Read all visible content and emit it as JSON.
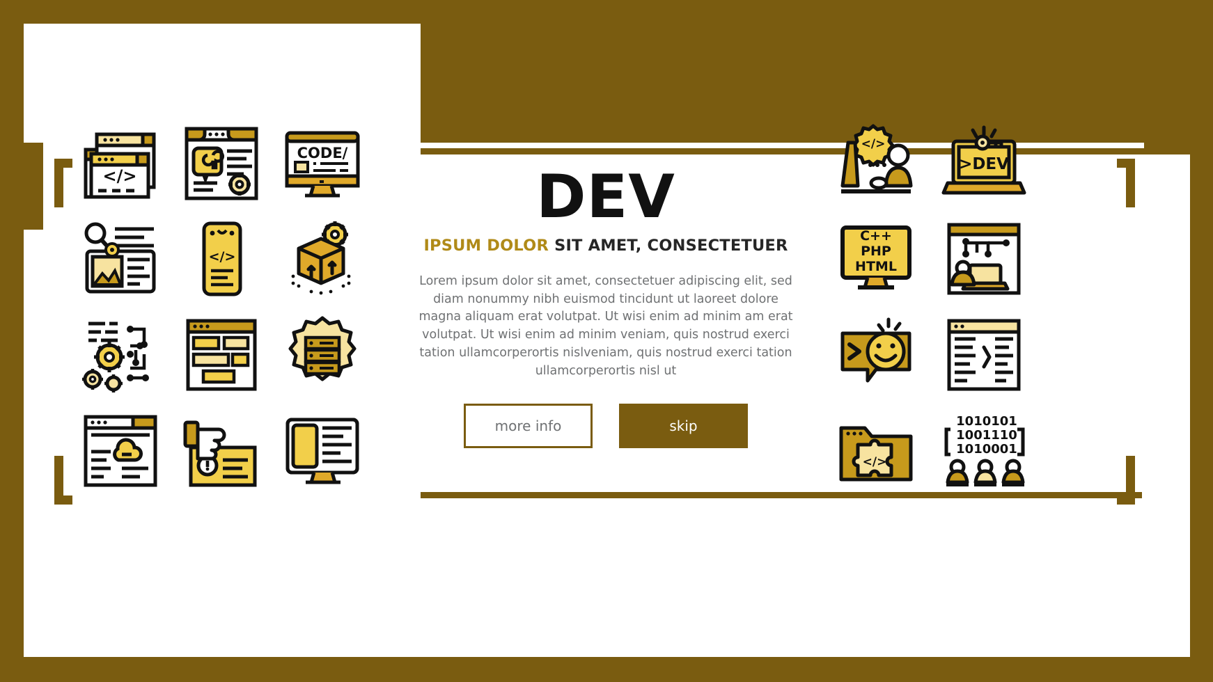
{
  "palette": {
    "brand_brown": "#7a5c10",
    "gold": "#b08a18",
    "yellow": "#f2cf4a",
    "light_yellow": "#f7e3a0",
    "dark_yellow": "#c79a1c",
    "ink": "#111111",
    "body_gray": "#6f7173",
    "white": "#ffffff"
  },
  "hero": {
    "headline": "DEV",
    "subtitle_gold": "IPSUM DOLOR",
    "subtitle_dark": "SIT AMET, CONSECTETUER",
    "body": "Lorem ipsum dolor sit amet, consectetuer adipiscing elit, sed diam nonummy nibh euismod tincidunt ut laoreet dolore magna aliquam erat volutpat. Ut wisi enim ad minim am erat volutpat. Ut wisi enim ad minim veniam, quis nostrud exerci tation ullamcorperortis nislveniam, quis nostrud exerci tation ullamcorperortis nisl ut",
    "primary_button": "more info",
    "secondary_button": "skip"
  },
  "icons_left": [
    {
      "name": "code-windows-icon",
      "label": "</>"
    },
    {
      "name": "document-wrench-settings-icon",
      "label": ""
    },
    {
      "name": "code-monitor-icon",
      "label": "CODE/"
    },
    {
      "name": "image-search-document-icon",
      "label": ""
    },
    {
      "name": "mobile-code-icon",
      "label": "</>"
    },
    {
      "name": "package-gear-deploy-icon",
      "label": ""
    },
    {
      "name": "gears-circuit-icon",
      "label": ""
    },
    {
      "name": "wireframe-layout-icon",
      "label": ""
    },
    {
      "name": "server-gear-icon",
      "label": ""
    },
    {
      "name": "browser-cloud-icon",
      "label": ""
    },
    {
      "name": "hand-debug-alert-icon",
      "label": ""
    },
    {
      "name": "responsive-monitor-mobile-icon",
      "label": ""
    }
  ],
  "icons_right": [
    {
      "name": "developer-workstation-gear-code-icon",
      "label": "</>"
    },
    {
      "name": "laptop-key-dev-icon",
      "label": ">DEV"
    },
    {
      "name": "languages-monitor-icon",
      "label": "C++ PHP HTML"
    },
    {
      "name": "laptop-network-user-icon",
      "label": ""
    },
    {
      "name": "bug-smiley-chat-icon",
      "label": ""
    },
    {
      "name": "code-document-lines-icon",
      "label": ""
    },
    {
      "name": "folder-puzzle-code-icon",
      "label": "</>"
    },
    {
      "name": "binary-team-icon",
      "label": "1010101 1001110 1010001"
    }
  ],
  "icon_text": {
    "code_tag": "</>",
    "code_label": "CODE/",
    "dev_prompt": ">DEV",
    "lang_cpp": "C++",
    "lang_php": "PHP",
    "lang_html": "HTML",
    "binary_1": "1010101",
    "binary_2": "1001110",
    "binary_3": "1010001"
  }
}
